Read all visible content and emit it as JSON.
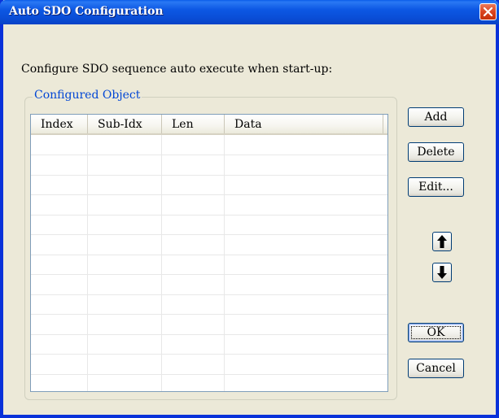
{
  "window": {
    "title": "Auto SDO Configuration"
  },
  "prompt": "Configure SDO sequence auto execute when start-up:",
  "group": {
    "label": "Configured Object"
  },
  "list": {
    "columns": [
      "Index",
      "Sub-Idx",
      "Len",
      "Data"
    ],
    "rows": []
  },
  "buttons": {
    "add": "Add",
    "delete": "Delete",
    "edit": "Edit...",
    "ok": "OK",
    "cancel": "Cancel"
  },
  "icons": {
    "close": "close-icon",
    "move_up": "arrow-up-icon",
    "move_down": "arrow-down-icon"
  },
  "colors": {
    "title_bar": "#0a4fd8",
    "group_label": "#0046d5",
    "close_button": "#d9441f"
  }
}
